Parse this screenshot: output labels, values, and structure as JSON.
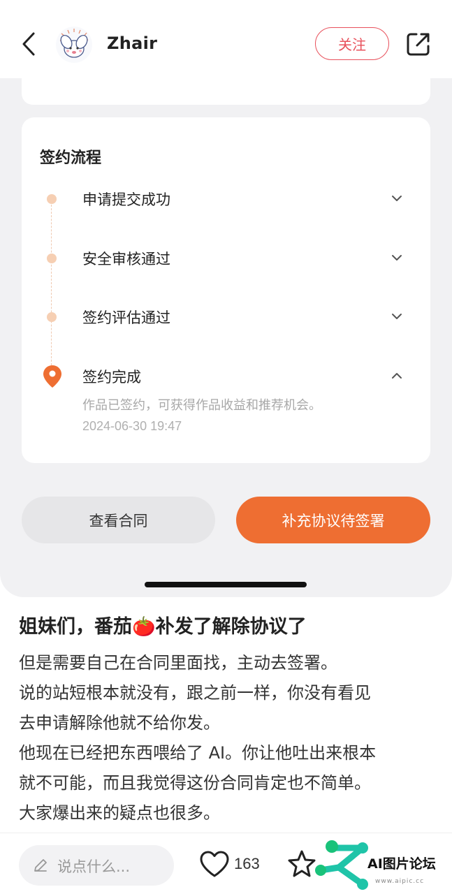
{
  "header": {
    "username": "Zhair",
    "follow_label": "关注",
    "icons": {
      "back": "chevron-left-icon",
      "share": "share-external-icon"
    }
  },
  "panel": {
    "card_title": "签约流程",
    "steps": [
      {
        "label": "申请提交成功",
        "expanded": false
      },
      {
        "label": "安全审核通过",
        "expanded": false
      },
      {
        "label": "签约评估通过",
        "expanded": false
      },
      {
        "label": "签约完成",
        "expanded": true,
        "description": "作品已签约，可获得作品收益和推荐机会。",
        "time": "2024-06-30 19:47"
      }
    ],
    "view_contract_label": "查看合同",
    "sign_label": "补充协议待签署",
    "colors": {
      "accent": "#ee6e32",
      "timeline_dot": "#f6cfb3"
    }
  },
  "post": {
    "title": "姐妹们，番茄🍅补发了解除协议了",
    "body_lines": [
      "但是需要自己在合同里面找，主动去签署。",
      "说的站短根本就没有，跟之前一样，你没有看见",
      "去申请解除他就不给你发。",
      "他现在已经把东西喂给了 AI。你让他吐出来根本",
      "就不可能，而且我觉得这份合同肯定也不简单。",
      "大家爆出来的疑点也很多。"
    ]
  },
  "bottom_bar": {
    "comment_placeholder": "说点什么...",
    "like_count": "163"
  },
  "watermark": {
    "text": "AI图片论坛",
    "url": "www.aipic.cc"
  }
}
